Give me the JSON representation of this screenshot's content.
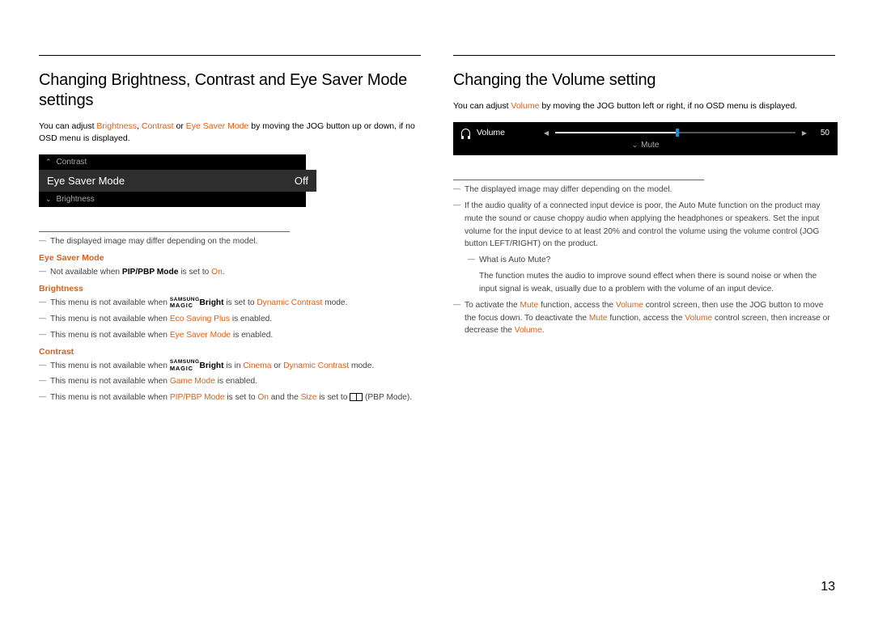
{
  "page_number": "13",
  "left": {
    "heading": "Changing Brightness, Contrast and Eye Saver Mode settings",
    "intro_pre": "You can adjust ",
    "intro_terms": [
      "Brightness",
      "Contrast",
      "Eye Saver Mode"
    ],
    "intro_post": " by moving the JOG button up or down, if no OSD menu is displayed.",
    "osd": {
      "up_label": "Contrast",
      "mid_label": "Eye Saver Mode",
      "mid_value": "Off",
      "down_label": "Brightness"
    },
    "disclaimer": "The displayed image may differ depending on the model.",
    "sections": [
      {
        "title": "Eye Saver Mode",
        "items": [
          {
            "parts": [
              "Not available when ",
              {
                "b": "PIP/PBP Mode"
              },
              " is set to ",
              {
                "o": "On"
              },
              "."
            ]
          }
        ]
      },
      {
        "title": "Brightness",
        "items": [
          {
            "parts": [
              "This menu is not available when ",
              {
                "magic": "Bright"
              },
              " is set to ",
              {
                "o": "Dynamic Contrast"
              },
              " mode."
            ]
          },
          {
            "parts": [
              "This menu is not available when ",
              {
                "o": "Eco Saving Plus"
              },
              " is enabled."
            ]
          },
          {
            "parts": [
              "This menu is not available when ",
              {
                "o": "Eye Saver Mode"
              },
              " is enabled."
            ]
          }
        ]
      },
      {
        "title": "Contrast",
        "items": [
          {
            "parts": [
              "This menu is not available when ",
              {
                "magic": "Bright"
              },
              " is in ",
              {
                "o": "Cinema"
              },
              " or ",
              {
                "o": "Dynamic Contrast"
              },
              " mode."
            ]
          },
          {
            "parts": [
              "This menu is not available when ",
              {
                "o": "Game Mode"
              },
              " is enabled."
            ]
          },
          {
            "parts": [
              "This menu is not available when ",
              {
                "o": "PIP/PBP Mode"
              },
              " is set to ",
              {
                "o": "On"
              },
              " and the ",
              {
                "o": "Size"
              },
              " is set to ",
              {
                "pbp": true
              },
              " (PBP Mode)."
            ]
          }
        ]
      }
    ]
  },
  "right": {
    "heading": "Changing the Volume setting",
    "intro_pre": "You can adjust ",
    "intro_term": "Volume",
    "intro_post": " by moving the JOG button left or right, if no OSD menu is displayed.",
    "osd": {
      "label": "Volume",
      "value": "50",
      "mute_label": "Mute"
    },
    "disclaimer": "The displayed image may differ depending on the model.",
    "items": [
      {
        "parts": [
          "If the audio quality of a connected input device is poor, the Auto Mute function on the product may mute the sound or cause choppy audio when applying the headphones or speakers. Set the input volume for the input device to at least 20% and control the volume using the volume control (JOG button LEFT/RIGHT) on the product."
        ]
      },
      {
        "nested": true,
        "parts": [
          "What is Auto Mute?"
        ]
      },
      {
        "plain_nested": true,
        "parts": [
          "The function mutes the audio to improve sound effect when there is sound noise or when the input signal is weak, usually due to a problem with the volume of an input device."
        ]
      },
      {
        "parts": [
          "To activate the ",
          {
            "o": "Mute"
          },
          " function, access the ",
          {
            "o": "Volume"
          },
          " control screen, then use the JOG button to move the focus down. To deactivate the ",
          {
            "o": "Mute"
          },
          " function, access the ",
          {
            "o": "Volume"
          },
          " control screen, then increase or decrease the ",
          {
            "o": "Volume"
          },
          "."
        ]
      }
    ]
  }
}
